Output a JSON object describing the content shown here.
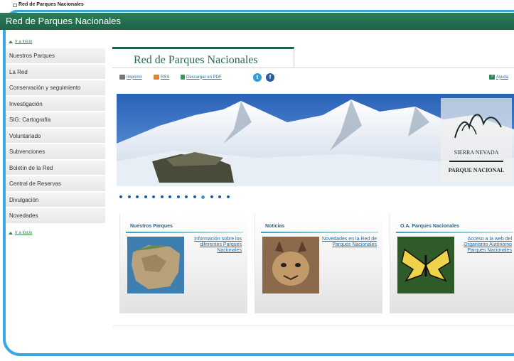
{
  "window": {
    "title": "Red de Parques Nacionales"
  },
  "banner": {
    "title": "Red de Parques Nacionales"
  },
  "sidebar": {
    "skip_top": "Ir a Inicio",
    "skip_bottom": "Ir a Inicio",
    "items": [
      {
        "label": "Nuestros Parques"
      },
      {
        "label": "La Red"
      },
      {
        "label": "Conservación y seguimiento"
      },
      {
        "label": "Investigación"
      },
      {
        "label": "SIG: Cartografía"
      },
      {
        "label": "Voluntariado"
      },
      {
        "label": "Subvenciones"
      },
      {
        "label": "Boletín de la Red"
      },
      {
        "label": "Central de Reservas"
      },
      {
        "label": "Divulgación"
      },
      {
        "label": "Novedades"
      }
    ]
  },
  "main": {
    "tab_title": "Red de Parques Nacionales",
    "toolbar": {
      "print": "Imprimir",
      "rss": "RSS",
      "pdf": "Descargar en PDF",
      "help": "Ayuda"
    },
    "hero": {
      "logo_line1": "SIERRA NEVADA",
      "logo_line2": "PARQUE NACIONAL"
    },
    "carousel": {
      "count": 14,
      "active_index": 10
    },
    "cards": [
      {
        "title": "Nuestros Parques",
        "link": "Información sobre los diferentes Parques Nacionales"
      },
      {
        "title": "Noticias",
        "link": "Novedades en la Red de Parques Nacionales"
      },
      {
        "title": "O.A. Parques Nacionales",
        "link": "Acceso a la web del Organismo Autónomo Parques Nacionales"
      }
    ]
  },
  "colors": {
    "frame": "#39a7e0",
    "banner": "#1e6347",
    "link": "#1a6fb2",
    "card_title": "#2b6485"
  }
}
